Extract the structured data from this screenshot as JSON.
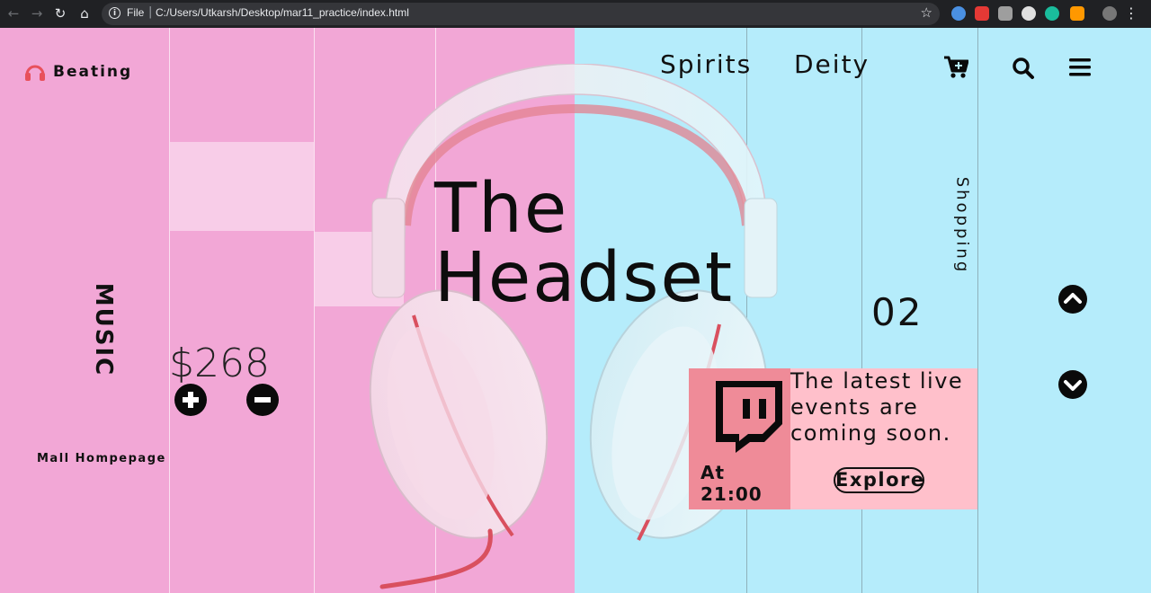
{
  "browser": {
    "scheme": "File",
    "url": "C:/Users/Utkarsh/Desktop/mar11_practice/index.html"
  },
  "logo": {
    "text": "Beating",
    "color": "#e8505b"
  },
  "side": {
    "music": "MUSIC",
    "shopping": "Shopping",
    "mall": "Mall Hompepage"
  },
  "price": "$268",
  "hero": {
    "line1": "The",
    "line2": "Headset"
  },
  "nav": {
    "spirits": "Spirits",
    "deity": "Deity"
  },
  "counter": "02",
  "event": {
    "time": "At 21:00",
    "text": "The latest live events are coming soon.",
    "cta": "Explore"
  },
  "colors": {
    "pink": "#f2a7d6",
    "blue": "#b5ecfb",
    "card": "#ffc0cb",
    "card_accent": "#ef8b98"
  }
}
